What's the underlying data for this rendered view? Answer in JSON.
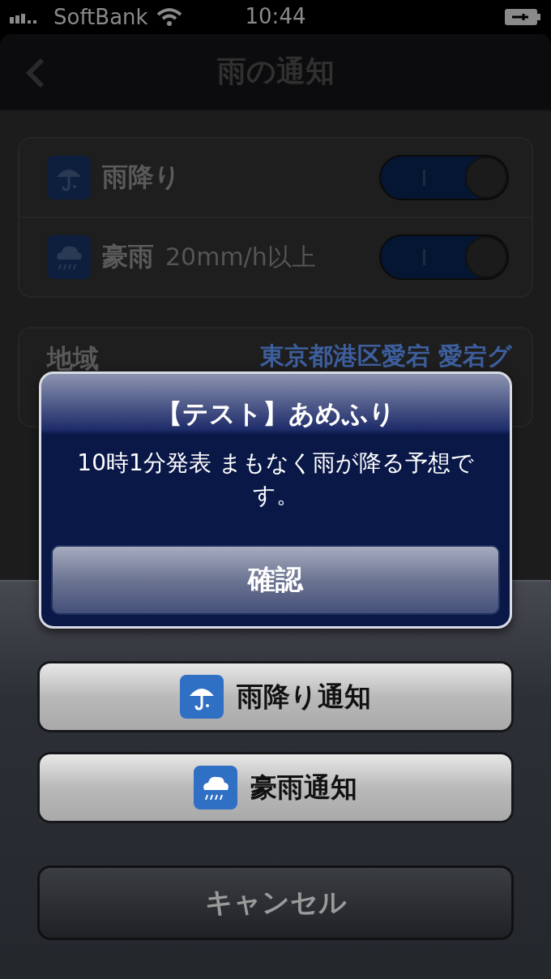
{
  "status_bar": {
    "carrier": "SoftBank",
    "time": "10:44"
  },
  "nav_bar": {
    "title": "雨の通知"
  },
  "settings": [
    {
      "kind": "umbrella",
      "label": "雨降り",
      "on": true
    },
    {
      "kind": "cloud",
      "label": "豪雨",
      "note": "20mm/h以上",
      "on": true
    }
  ],
  "location": {
    "label": "地域",
    "value": "東京都港区愛宕 愛宕グ"
  },
  "alert": {
    "title": "【テスト】あめふり",
    "message": "10時1分発表 まもなく雨が降る予想です。",
    "button": "確認"
  },
  "action_sheet": {
    "buttons": [
      {
        "kind": "umbrella",
        "label": "雨降り通知"
      },
      {
        "kind": "cloud",
        "label": "豪雨通知"
      }
    ],
    "cancel": "キャンセル"
  }
}
